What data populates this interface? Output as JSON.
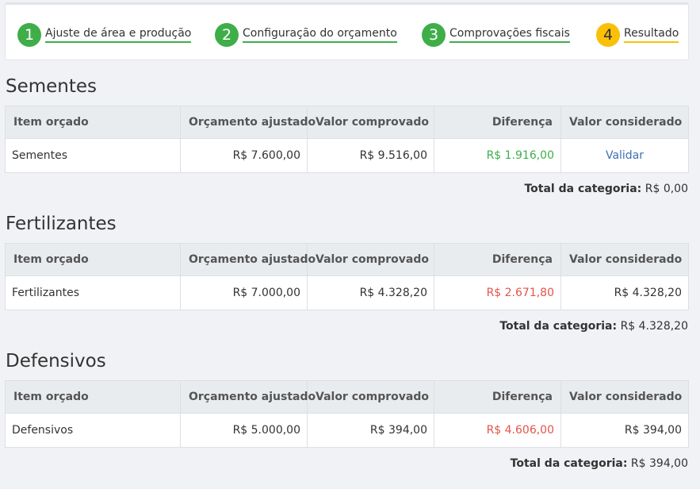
{
  "steps": [
    {
      "number": "1",
      "label": "Ajuste de área e produção",
      "status": "done"
    },
    {
      "number": "2",
      "label": "Configuração do orçamento",
      "status": "done"
    },
    {
      "number": "3",
      "label": "Comprovações fiscais",
      "status": "done"
    },
    {
      "number": "4",
      "label": "Resultado",
      "status": "current"
    }
  ],
  "columns": [
    "Item orçado",
    "Orçamento ajustado",
    "Valor comprovado",
    "Diferença",
    "Valor considerado"
  ],
  "total_label": "Total da categoria:",
  "colors": {
    "positive": "#3fae49",
    "negative": "#e5534b",
    "link": "#3d6fb6",
    "step_done": "#3fae49",
    "step_current": "#fac008"
  },
  "sections": [
    {
      "title": "Sementes",
      "row": {
        "item": "Sementes",
        "budget": "R$ 7.600,00",
        "proven": "R$ 9.516,00",
        "difference": "R$ 1.916,00",
        "considered": "Validar"
      },
      "total": "R$ 0,00"
    },
    {
      "title": "Fertilizantes",
      "row": {
        "item": "Fertilizantes",
        "budget": "R$ 7.000,00",
        "proven": "R$ 4.328,20",
        "difference": "R$ 2.671,80",
        "considered": "R$ 4.328,20"
      },
      "total": "R$ 4.328,20"
    },
    {
      "title": "Defensivos",
      "row": {
        "item": "Defensivos",
        "budget": "R$ 5.000,00",
        "proven": "R$ 394,00",
        "difference": "R$ 4.606,00",
        "considered": "R$ 394,00"
      },
      "total": "R$ 394,00"
    }
  ]
}
